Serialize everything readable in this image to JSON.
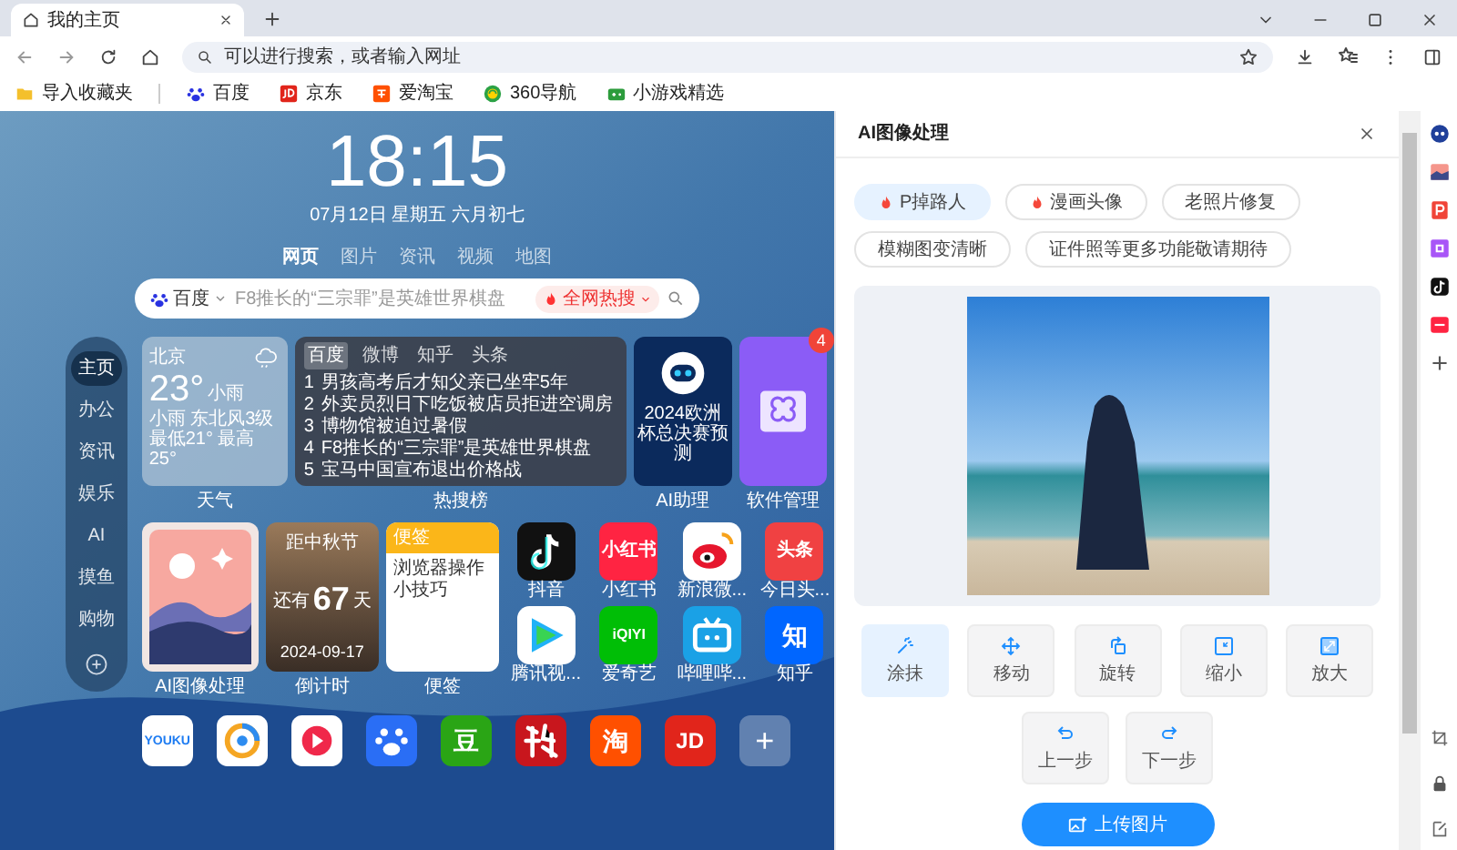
{
  "browser": {
    "tabs": [
      {
        "title": "我的主页",
        "selected": true
      }
    ],
    "address": {
      "placeholder": "可以进行搜索，或者输入网址"
    },
    "bookmarks": [
      {
        "label": "导入收藏夹",
        "kind": "folder"
      },
      {
        "label": "百度",
        "kind": "baidu"
      },
      {
        "label": "京东",
        "kind": "jd"
      },
      {
        "label": "爱淘宝",
        "kind": "taobao"
      },
      {
        "label": "360导航",
        "kind": "nav360"
      },
      {
        "label": "小游戏精选",
        "kind": "games"
      }
    ]
  },
  "home": {
    "clock": "18:15",
    "date": "07月12日 星期五 六月初七",
    "search_tabs": [
      {
        "label": "网页",
        "selected": true
      },
      {
        "label": "图片",
        "selected": false
      },
      {
        "label": "资讯",
        "selected": false
      },
      {
        "label": "视频",
        "selected": false
      },
      {
        "label": "地图",
        "selected": false
      }
    ],
    "search": {
      "engine": "百度",
      "placeholder": "F8推长的“三宗罪”是英雄世界棋盘",
      "hot_button": "全网热搜"
    },
    "nav": [
      {
        "label": "主页",
        "selected": true
      },
      {
        "label": "办公",
        "selected": false
      },
      {
        "label": "资讯",
        "selected": false
      },
      {
        "label": "娱乐",
        "selected": false
      },
      {
        "label": "AI",
        "selected": false
      },
      {
        "label": "摸鱼",
        "selected": false
      },
      {
        "label": "购物",
        "selected": false
      }
    ],
    "weather": {
      "city": "北京",
      "icon_label": "小雨",
      "temp": "23°",
      "condition": "小雨 东北风3级",
      "range": "最低21° 最高25°",
      "label": "天气"
    },
    "hot": {
      "tabs": [
        {
          "label": "百度",
          "selected": true
        },
        {
          "label": "微博",
          "selected": false
        },
        {
          "label": "知乎",
          "selected": false
        },
        {
          "label": "头条",
          "selected": false
        }
      ],
      "items": [
        {
          "rank": "1",
          "title": "男孩高考后才知父亲已坐牢5年"
        },
        {
          "rank": "2",
          "title": "外卖员烈日下吃饭被店员拒进空调房"
        },
        {
          "rank": "3",
          "title": "博物馆被迫过暑假"
        },
        {
          "rank": "4",
          "title": "F8推长的“三宗罪”是英雄世界棋盘"
        },
        {
          "rank": "5",
          "title": "宝马中国宣布退出价格战"
        }
      ],
      "label": "热搜榜"
    },
    "ai_assistant": {
      "caption": "2024欧洲杯总决赛预测",
      "label": "AI助理"
    },
    "software": {
      "badge": "4",
      "label": "软件管理"
    },
    "ai_image": {
      "label": "AI图像处理"
    },
    "countdown": {
      "event": "距中秋节",
      "prefix": "还有",
      "days": "67",
      "unit": "天",
      "date": "2024-09-17",
      "label": "倒计时"
    },
    "note": {
      "header": "便签",
      "text": "浏览器操作小技巧",
      "label": "便签"
    },
    "apps": [
      {
        "kind": "douyin",
        "label": "抖音"
      },
      {
        "kind": "xiaohongshu",
        "label": "小红书",
        "icon_text": "小红书"
      },
      {
        "kind": "weibo",
        "label": "新浪微..."
      },
      {
        "kind": "toutiao",
        "label": "今日头...",
        "icon_text": "头条"
      },
      {
        "kind": "tencent_video",
        "label": "腾讯视..."
      },
      {
        "kind": "iqiyi",
        "label": "爱奇艺",
        "icon_text": "iQIYI"
      },
      {
        "kind": "bilibili",
        "label": "哔哩哔..."
      },
      {
        "kind": "zhihu",
        "label": "知乎",
        "icon_text": "知"
      }
    ],
    "dock": [
      {
        "kind": "youku",
        "icon_text": "YOUKU"
      },
      {
        "kind": "ring"
      },
      {
        "kind": "play_red"
      },
      {
        "kind": "baidu"
      },
      {
        "kind": "douban",
        "icon_text": "豆"
      },
      {
        "kind": "calligraphy"
      },
      {
        "kind": "taobao",
        "icon_text": "淘"
      },
      {
        "kind": "jd",
        "icon_text": "JD"
      },
      {
        "kind": "add",
        "icon_text": "+"
      }
    ]
  },
  "panel": {
    "title": "AI图像处理",
    "features": [
      {
        "label": "P掉路人",
        "hot": true,
        "selected": true
      },
      {
        "label": "漫画头像",
        "hot": true,
        "selected": false
      },
      {
        "label": "老照片修复",
        "hot": false,
        "selected": false
      },
      {
        "label": "模糊图变清晰",
        "hot": false,
        "selected": false
      },
      {
        "label": "证件照等更多功能敬请期待",
        "hot": false,
        "selected": false
      }
    ],
    "tools": [
      {
        "label": "涂抹",
        "kind": "smear",
        "selected": true
      },
      {
        "label": "移动",
        "kind": "move",
        "selected": false
      },
      {
        "label": "旋转",
        "kind": "rotate",
        "selected": false
      },
      {
        "label": "缩小",
        "kind": "shrink",
        "selected": false
      },
      {
        "label": "放大",
        "kind": "enlarge",
        "selected": false
      }
    ],
    "history": [
      {
        "label": "上一步",
        "kind": "undo"
      },
      {
        "label": "下一步",
        "kind": "redo"
      }
    ],
    "upload": "上传图片"
  }
}
